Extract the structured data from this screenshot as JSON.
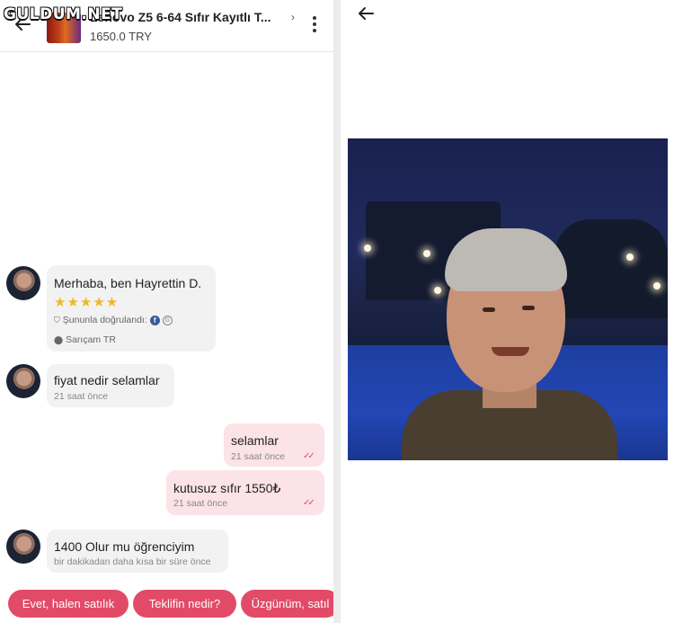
{
  "watermark": "GULDUM.NET",
  "header": {
    "title": "Lenovo Z5 6-64 Sıfır Kayıtlı T...",
    "price": "1650.0 TRY"
  },
  "profile": {
    "name": "Merhaba, ben Hayrettin D.",
    "stars": "★★★★★",
    "verified": "Şununla doğrulandı:",
    "location": "Sarıçam TR"
  },
  "messages": [
    {
      "text": "fiyat nedir selamlar",
      "time": "21 saat önce"
    },
    {
      "text": "selamlar",
      "time": "21 saat önce"
    },
    {
      "text": "kutusuz sıfır 1550₺",
      "time": "21 saat önce"
    },
    {
      "text": "1400 Olur mu öğrenciyim",
      "time": "bir dakikadan daha kısa bir süre önce"
    }
  ],
  "quick_replies": [
    "Evet, halen satılık",
    "Teklifin nedir?",
    "Üzgünüm, satıl"
  ],
  "colors": {
    "accent": "#e24b67",
    "outgoing_bubble": "#fbe3e7",
    "incoming_bubble": "#f2f2f2",
    "star": "#f1b823"
  }
}
